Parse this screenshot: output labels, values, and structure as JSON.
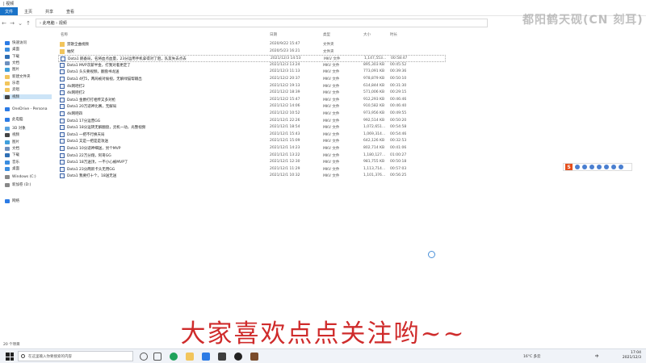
{
  "window": {
    "title": "| 视频"
  },
  "ribbon": {
    "tabs": [
      "文件",
      "主页",
      "共享",
      "查看"
    ]
  },
  "watermark": "都阳鹤天砚(CN 刻耳)",
  "address": {
    "path": "› 此电脑 › 视频"
  },
  "sidebar": {
    "items": [
      {
        "label": "快速访问",
        "color": "#2c7be5"
      },
      {
        "label": "桌面",
        "color": "#3a8de0"
      },
      {
        "label": "下载",
        "color": "#2f6fb5"
      },
      {
        "label": "文档",
        "color": "#6d8fbf"
      },
      {
        "label": "图片",
        "color": "#3f9fdc"
      },
      {
        "label": "新建文件夹",
        "color": "#f2c55c"
      },
      {
        "label": "乐谱",
        "color": "#f2c55c"
      },
      {
        "label": "卖唱",
        "color": "#f2c55c"
      },
      {
        "label": "视频",
        "color": "#444444",
        "selected": true
      },
      {
        "label": "OneDrive - Persona",
        "color": "#2c7be5"
      },
      {
        "label": "此电脑",
        "color": "#2c7be5"
      },
      {
        "label": "3D 对象",
        "color": "#5aa4e0"
      },
      {
        "label": "视频",
        "color": "#444444"
      },
      {
        "label": "图片",
        "color": "#3f9fdc"
      },
      {
        "label": "文档",
        "color": "#6d8fbf"
      },
      {
        "label": "下载",
        "color": "#2f6fb5"
      },
      {
        "label": "音乐",
        "color": "#3a8de0"
      },
      {
        "label": "桌面",
        "color": "#3a8de0"
      },
      {
        "label": "Windows (C:)",
        "color": "#888888"
      },
      {
        "label": "新加卷 (D:)",
        "color": "#888888"
      },
      {
        "label": "网络",
        "color": "#2c7be5"
      }
    ]
  },
  "columns": {
    "name": "名称",
    "date": "日期",
    "type": "类型",
    "size": "大小",
    "duration": "时长"
  },
  "files": [
    {
      "name": "禁歌全曲视频",
      "date": "2020/9/22 15:47",
      "type": "文件夹",
      "size": "",
      "duration": "",
      "kind": "folder"
    },
    {
      "name": "抽奖",
      "date": "2020/5/23 16:21",
      "type": "文件夹",
      "size": "",
      "duration": "",
      "kind": "folder"
    },
    {
      "name": "Dota1   鹅备局，名将血点血量，23分运用手机拿得对了阻，队友失去点去",
      "date": "2021/12/3 14:53",
      "type": "MKV 文件",
      "size": "1,147,553...",
      "duration": "00:58:47",
      "kind": "video"
    },
    {
      "name": "Dota1   MVP次薪半金，打我对着更定了",
      "date": "2021/12/3 13:24",
      "type": "MKV 文件",
      "size": "895,303 KB",
      "duration": "00:45:52",
      "kind": "video"
    },
    {
      "name": "Dota1   头头要视频，翻盘书龙送",
      "date": "2021/12/3 11:13",
      "type": "MKV 文件",
      "size": "773,091 KB",
      "duration": "00:39:36",
      "kind": "video"
    },
    {
      "name": "Dota1   4打5，两局被对偷视，无解绿猫帮输出",
      "date": "2021/12/2 20:37",
      "type": "MKV 文件",
      "size": "978,879 KB",
      "duration": "00:50:10",
      "kind": "video"
    },
    {
      "name": "4k网吧打2",
      "date": "2021/12/2 19:13",
      "type": "MKV 文件",
      "size": "614,844 KB",
      "duration": "00:31:30",
      "kind": "video"
    },
    {
      "name": "4k网吧打2",
      "date": "2021/12/2 18:39",
      "type": "MKV 文件",
      "size": "571,006 KB",
      "duration": "00:29:15",
      "kind": "video"
    },
    {
      "name": "Dota1   金爵打打相传又多对枪",
      "date": "2021/12/2 15:47",
      "type": "MKV 文件",
      "size": "912,293 KB",
      "duration": "00:46:46",
      "kind": "video"
    },
    {
      "name": "Dota1   20万适神比赛，无解局",
      "date": "2021/12/2 14:06",
      "type": "MKV 文件",
      "size": "910,582 KB",
      "duration": "00:46:40",
      "kind": "video"
    },
    {
      "name": "4k网吧四",
      "date": "2021/12/2 10:52",
      "type": "MKV 文件",
      "size": "973,956 KB",
      "duration": "00:49:55",
      "kind": "video"
    },
    {
      "name": "Dota1   17分运营GG",
      "date": "2021/12/1 22:26",
      "type": "MKV 文件",
      "size": "992,514 KB",
      "duration": "00:50:20",
      "kind": "video"
    },
    {
      "name": "Dota1   18分运转无解翻盘，灵机一动，光整视频",
      "date": "2021/12/1 18:54",
      "type": "MKV 文件",
      "size": "1,072,651...",
      "duration": "00:54:58",
      "kind": "video"
    },
    {
      "name": "Dota1   一把不行换天局",
      "date": "2021/12/1 15:43",
      "type": "MKV 文件",
      "size": "1,069,314...",
      "duration": "00:54:46",
      "kind": "video"
    },
    {
      "name": "Dota1   又是一把是是攻送",
      "date": "2021/12/1 15:09",
      "type": "MKV 文件",
      "size": "642,126 KB",
      "duration": "00:32:53",
      "kind": "video"
    },
    {
      "name": "Dota1   10分适神细送，另个MVP",
      "date": "2021/12/1 14:23",
      "type": "MKV 文件",
      "size": "802,714 KB",
      "duration": "00:41:06",
      "kind": "video"
    },
    {
      "name": "Dota1   22万分翔，阿哥GG",
      "date": "2021/12/1 13:22",
      "type": "MKV 文件",
      "size": "1,180,127...",
      "duration": "01:00:27",
      "kind": "video"
    },
    {
      "name": "Dota1   18万送顶，一不小心被MVP了",
      "date": "2021/12/1 12:30",
      "type": "MKV 文件",
      "size": "981,755 KB",
      "duration": "00:50:18",
      "kind": "video"
    },
    {
      "name": "Dota1   23分两新卡头无用GG",
      "date": "2021/12/1 11:29",
      "type": "MKV 文件",
      "size": "1,113,714...",
      "duration": "00:57:03",
      "kind": "video"
    },
    {
      "name": "Dota1   我要打十个，18送无送",
      "date": "2021/12/1 10:32",
      "type": "MKV 文件",
      "size": "1,101,376...",
      "duration": "00:56:25",
      "kind": "video"
    }
  ],
  "subtitle": "大家喜欢点点关注哟~~",
  "status": {
    "count": "20 个项目"
  },
  "taskbar": {
    "search_placeholder": "在这里输入你要搜索的内容",
    "weather": "16°C  多云",
    "ime_lang": "中",
    "time": "17:04",
    "date": "2021/12/3"
  },
  "ime_toolbar": {
    "logo": "S"
  }
}
